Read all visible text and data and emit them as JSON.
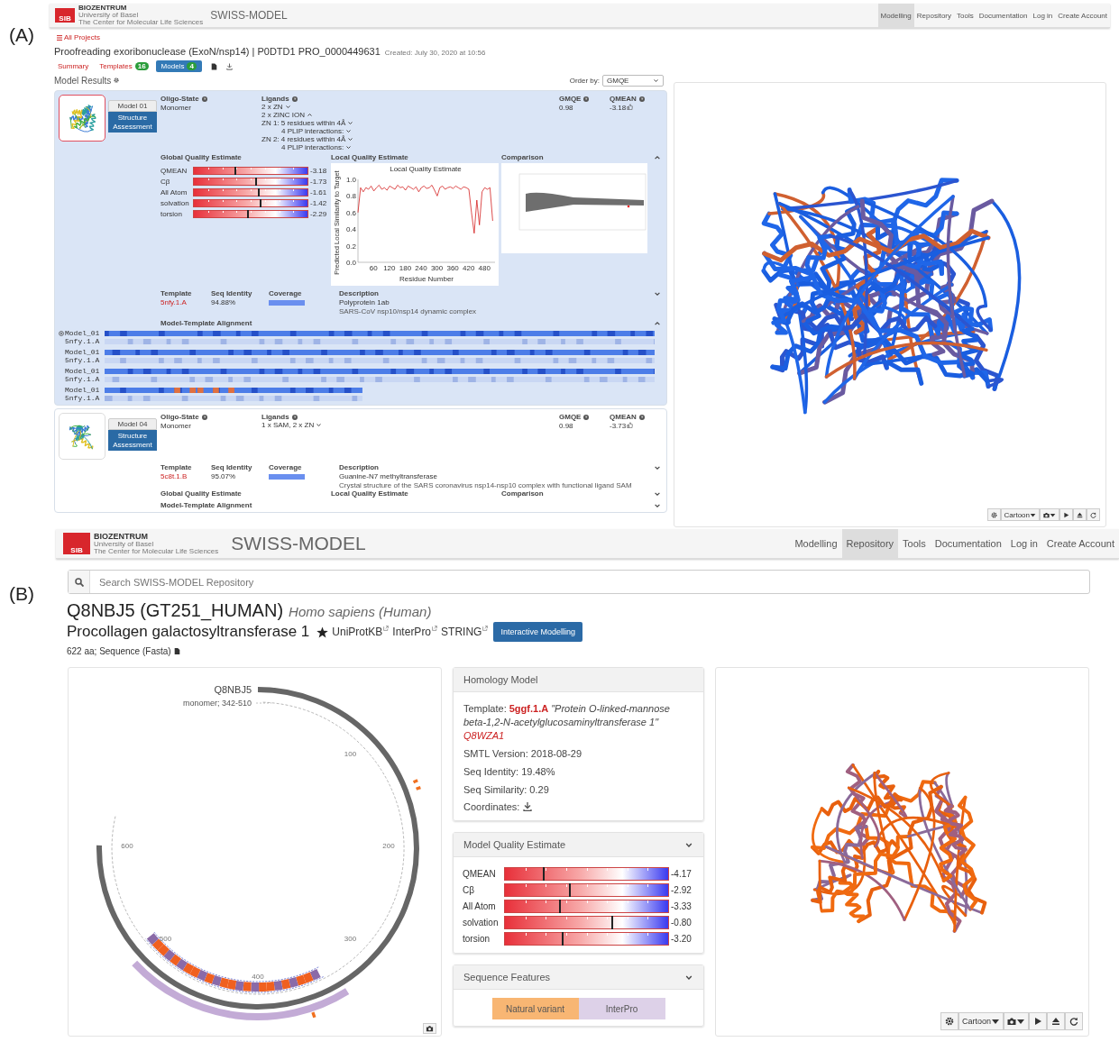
{
  "panel_a": {
    "label": "(A)",
    "header": {
      "logo": "SIB",
      "brand": "BIOZENTRUM",
      "brand_sub": "University of Basel",
      "brand_sub2": "The Center for Molecular Life Sciences",
      "title": "SWISS-MODEL",
      "nav": [
        {
          "label": "Modelling",
          "selected": true
        },
        {
          "label": "Repository",
          "selected": false
        },
        {
          "label": "Tools",
          "selected": false
        },
        {
          "label": "Documentation",
          "selected": false
        },
        {
          "label": "Log in",
          "selected": false
        },
        {
          "label": "Create Account",
          "selected": false
        }
      ]
    },
    "breadcrumb": "All Projects",
    "project_title": "Proofreading exoribonuclease (ExoN/nsp14) | P0DTD1 PRO_0000449631",
    "created": "Created: July 30, 2020 at 10:56",
    "tabs": [
      {
        "label": "Summary",
        "selected": false
      },
      {
        "label": "Templates",
        "badge": "16",
        "selected": false
      },
      {
        "label": "Models",
        "badge": "4",
        "selected": true
      }
    ],
    "section_title": "Model Results",
    "order_by": {
      "label": "Order by:",
      "value": "GMQE"
    },
    "models": [
      {
        "name": "Model 01",
        "selected": true,
        "expanded": true,
        "button": "Structure Assessment",
        "oligo_label": "Oligo-State",
        "oligo": "Monomer",
        "ligands_label": "Ligands",
        "ligands": [
          {
            "text": "2 x ZN",
            "kind": "ligand",
            "expanded": false
          },
          {
            "text": "2 x ZINC ION",
            "kind": "name",
            "expanded": true
          },
          {
            "text": "ZN 1: 5 residues within 4Å",
            "kind": "site",
            "expanded": false
          },
          {
            "text": "4 PLIP interactions:",
            "kind": "detail",
            "expanded": false
          },
          {
            "text": "ZN 2: 4 residues within 4Å",
            "kind": "site",
            "expanded": false
          },
          {
            "text": "4 PLIP interactions:",
            "kind": "detail",
            "expanded": false
          }
        ],
        "gmqe_label": "GMQE",
        "gmqe": "0.98",
        "qmean_label": "QMEAN",
        "qmean": "-3.18",
        "global_title": "Global Quality Estimate",
        "quality": [
          {
            "name": "QMEAN",
            "level": 0.36,
            "value": "-3.18"
          },
          {
            "name": "Cβ",
            "level": 0.54,
            "value": "-1.73"
          },
          {
            "name": "All Atom",
            "level": 0.56,
            "value": "-1.61"
          },
          {
            "name": "solvation",
            "level": 0.58,
            "value": "-1.42"
          },
          {
            "name": "torsion",
            "level": 0.47,
            "value": "-2.29"
          }
        ],
        "local_title": "Local Quality Estimate",
        "chart_data": {
          "type": "line",
          "title": "Local Quality Estimate",
          "xlabel": "Residue Number",
          "ylabel": "Predicted Local Similarity to Target",
          "x": [
            1,
            11,
            21,
            31,
            41,
            51,
            61,
            71,
            81,
            91,
            101,
            111,
            121,
            131,
            141,
            151,
            161,
            171,
            181,
            191,
            201,
            211,
            221,
            231,
            241,
            251,
            261,
            271,
            281,
            291,
            301,
            311,
            321,
            331,
            341,
            351,
            361,
            371,
            381,
            391,
            401,
            411,
            421,
            431,
            441,
            451,
            461,
            471,
            481,
            491,
            501,
            511
          ],
          "series": [
            {
              "color": "#d42020",
              "values": [
                0.6,
                0.9,
                0.85,
                0.9,
                0.88,
                0.92,
                0.86,
                0.9,
                0.93,
                0.88,
                0.9,
                0.87,
                0.92,
                0.9,
                0.88,
                0.93,
                0.9,
                0.91,
                0.87,
                0.92,
                0.9,
                0.88,
                0.91,
                0.85,
                0.9,
                0.92,
                0.89,
                0.9,
                0.93,
                0.87,
                0.8,
                0.9,
                0.92,
                0.88,
                0.9,
                0.91,
                0.89,
                0.92,
                0.9,
                0.88,
                0.91,
                0.9,
                0.88,
                0.6,
                0.35,
                0.75,
                0.45,
                0.85,
                0.9,
                0.88,
                0.9,
                0.5
              ]
            }
          ],
          "xlim": [
            1,
            520
          ],
          "ylim": [
            0,
            1
          ],
          "xticks": [
            60,
            120,
            180,
            240,
            300,
            360,
            420,
            480
          ],
          "yticks": [
            {
              "value": 0,
              "label": "0.0"
            },
            {
              "value": 0.2,
              "label": "0.2"
            },
            {
              "value": 0.4,
              "label": "0.4"
            },
            {
              "value": 0.6,
              "label": "0.6"
            },
            {
              "value": 0.8,
              "label": "0.8"
            },
            {
              "value": 1,
              "label": "1.0"
            }
          ]
        },
        "comparison_title": "Comparison",
        "template_label": "Template",
        "template": "5nfy.1.A",
        "seqid_label": "Seq Identity",
        "seqid": "94.88%",
        "coverage_label": "Coverage",
        "description_label": "Description",
        "description": "Polyprotein 1ab",
        "description_detail": "SARS-CoV nsp10/nsp14 dynamic complex",
        "alignment_title": "Model-Template Alignment",
        "alignment": [
          {
            "model": "Model_01",
            "template": "5nfy.1.A"
          },
          {
            "model": "Model_01",
            "template": "5nfy.1.A"
          },
          {
            "model": "Model_01",
            "template": "5nfy.1.A"
          },
          {
            "model": "Model_01",
            "template": "5nfy.1.A"
          }
        ]
      },
      {
        "name": "Model 04",
        "selected": false,
        "expanded": false,
        "button": "Structure Assessment",
        "oligo_label": "Oligo-State",
        "oligo": "Monomer",
        "ligands_label": "Ligands",
        "ligands": [
          {
            "text": "1 x SAM, 2 x ZN",
            "kind": "ligand",
            "expanded": false
          }
        ],
        "gmqe_label": "GMQE",
        "gmqe": "0.98",
        "qmean_label": "QMEAN",
        "qmean": "-3.73",
        "global_title": "Global Quality Estimate",
        "local_title": "Local Quality Estimate",
        "comparison_title": "Comparison",
        "template_label": "Template",
        "template": "5c8t.1.B",
        "seqid_label": "Seq Identity",
        "seqid": "95.07%",
        "coverage_label": "Coverage",
        "description_label": "Description",
        "description": "Guanine-N7 methyltransferase",
        "description_detail": "Crystal structure of the SARS coronavirus nsp14-nsp10 complex with functional ligand SAM",
        "alignment_title": "Model-Template Alignment"
      }
    ],
    "viewer": {
      "mode": "Cartoon"
    }
  },
  "panel_b": {
    "label": "(B)",
    "header": {
      "logo": "SIB",
      "brand": "BIOZENTRUM",
      "brand_sub": "University of Basel",
      "brand_sub2": "The Center for Molecular Life Sciences",
      "title": "SWISS-MODEL",
      "nav": [
        {
          "label": "Modelling",
          "selected": false
        },
        {
          "label": "Repository",
          "selected": true
        },
        {
          "label": "Tools",
          "selected": false
        },
        {
          "label": "Documentation",
          "selected": false
        },
        {
          "label": "Log in",
          "selected": false
        },
        {
          "label": "Create Account",
          "selected": false
        }
      ]
    },
    "search": {
      "placeholder": "Search SWISS-MODEL Repository"
    },
    "accession": "Q8NBJ5 (GT251_HUMAN)",
    "organism": "Homo sapiens (Human)",
    "protein": "Procollagen galactosyltransferase 1",
    "links": [
      "UniProtKB",
      "InterPro",
      "STRING"
    ],
    "action": "Interactive Modelling",
    "info": "622 aa; Sequence (Fasta)",
    "circle_plot": {
      "name": "Q8NBJ5",
      "model": "monomer; 342-510",
      "ticks": [
        "100",
        "200",
        "300",
        "400",
        "500",
        "600"
      ]
    },
    "homology": {
      "title": "Homology Model",
      "template_label": "Template:",
      "template": "5ggf.1.A",
      "template_name": "\"Protein O-linked-mannose beta-1,2-N-acetylglucosaminyltransferase 1\"",
      "uniprot": "Q8WZA1",
      "facts": [
        "SMTL Version: 2018-08-29",
        "Seq Identity: 19.48%",
        "Seq Similarity: 0.29"
      ],
      "coordinates": "Coordinates:"
    },
    "quality": {
      "title": "Model Quality Estimate",
      "rows": [
        {
          "name": "QMEAN",
          "level": 0.23,
          "value": "-4.17"
        },
        {
          "name": "Cβ",
          "level": 0.39,
          "value": "-2.92"
        },
        {
          "name": "All Atom",
          "level": 0.33,
          "value": "-3.33"
        },
        {
          "name": "solvation",
          "level": 0.65,
          "value": "-0.80"
        },
        {
          "name": "torsion",
          "level": 0.35,
          "value": "-3.20"
        }
      ]
    },
    "features": {
      "title": "Sequence Features",
      "items": [
        {
          "label": "Natural variant",
          "color": "#f8b673"
        },
        {
          "label": "InterPro",
          "color": "#ddd1e8"
        }
      ]
    },
    "viewer": {
      "mode": "Cartoon"
    }
  }
}
